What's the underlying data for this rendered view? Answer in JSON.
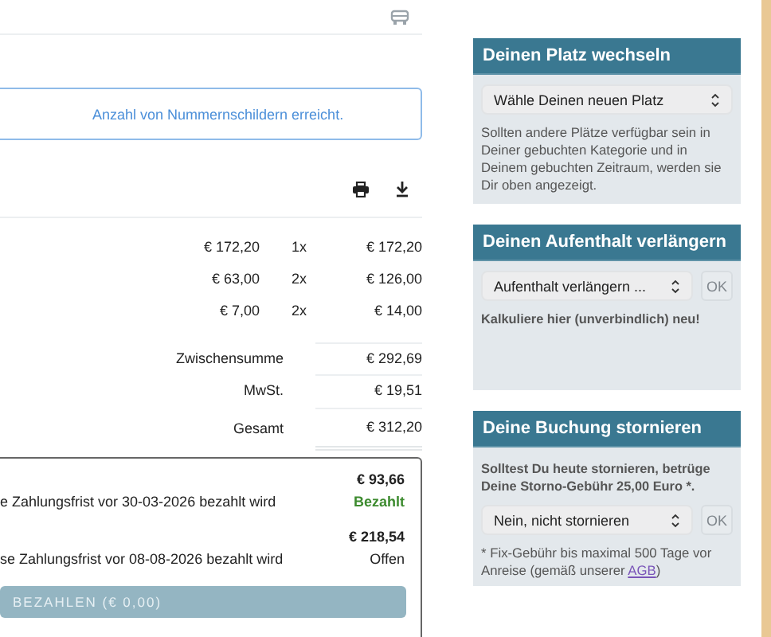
{
  "alert": {
    "text": "Anzahl von Nummernschildern erreicht."
  },
  "line_items": [
    {
      "unit_price": "€ 172,20",
      "quantity": "1x",
      "total": "€ 172,20"
    },
    {
      "unit_price": "€ 63,00",
      "quantity": "2x",
      "total": "€ 126,00"
    },
    {
      "unit_price": "€ 7,00",
      "quantity": "2x",
      "total": "€ 14,00"
    }
  ],
  "totals": [
    {
      "label": "Zwischensumme",
      "value": "€ 292,69"
    },
    {
      "label": "MwSt.",
      "value": "€ 19,51"
    },
    {
      "label": "Gesamt",
      "value": "€ 312,20"
    }
  ],
  "payments": [
    {
      "amount": "€ 93,66",
      "description": "e Zahlungsfrist vor 30-03-2026 bezahlt wird",
      "status": "Bezahlt",
      "paid": true
    },
    {
      "amount": "€ 218,54",
      "description": "se Zahlungsfrist vor 08-08-2026 bezahlt wird",
      "status": "Offen",
      "paid": false
    }
  ],
  "pay_button": {
    "label": "BEZAHLEN (€ 0,00)",
    "disabled": true
  },
  "panels": [
    {
      "title": "Deinen Platz wechseln",
      "select": "Wähle Deinen neuen Platz",
      "note": "Sollten andere Plätze verfügbar sein in Deiner gebuchten Kategorie und in Deinem gebuchten Zeitraum, werden sie Dir oben angezeigt."
    },
    {
      "title": "Deinen Aufenthalt verlängern",
      "select": "Aufenthalt verlängern ...",
      "ok": {
        "label": "OK",
        "disabled": true
      },
      "bold_note": "Kalkuliere hier (unverbindlich) neu!"
    },
    {
      "title": "Deine Buchung stornieren",
      "bold_note": "Solltest Du heute stornieren, betrüge Deine Storno-Gebühr 25,00 Euro *.",
      "select": "Nein, nicht stornieren",
      "ok": {
        "label": "OK",
        "disabled": true
      },
      "footnote": "* Fix-Gebühr bis maximal 500 Tage vor Anreise (gemäß unserer ",
      "footnote_link": "AGB",
      "footnote_end": ")"
    }
  ]
}
